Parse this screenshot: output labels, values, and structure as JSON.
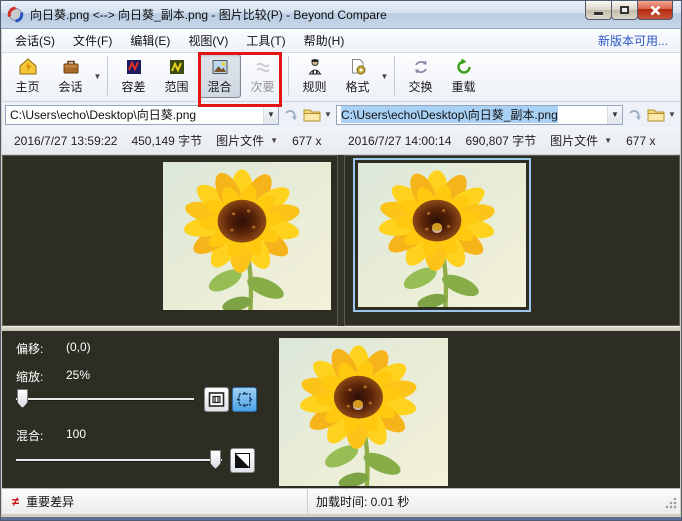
{
  "window": {
    "title": "向日葵.png <--> 向日葵_副本.png - 图片比较(P) - Beyond Compare",
    "update_link": "新版本可用..."
  },
  "menu": {
    "items": [
      {
        "label": "会话(S)"
      },
      {
        "label": "文件(F)"
      },
      {
        "label": "编辑(E)"
      },
      {
        "label": "视图(V)"
      },
      {
        "label": "工具(T)"
      },
      {
        "label": "帮助(H)"
      }
    ]
  },
  "toolbar": {
    "buttons": [
      {
        "label": "主页"
      },
      {
        "label": "会话"
      },
      {
        "label": "容差"
      },
      {
        "label": "范围"
      },
      {
        "label": "混合"
      },
      {
        "label": "次要"
      },
      {
        "label": "规则"
      },
      {
        "label": "格式"
      },
      {
        "label": "交换"
      },
      {
        "label": "重载"
      }
    ]
  },
  "paths": {
    "left_value": "C:\\Users\\echo\\Desktop\\向日葵.png",
    "right_value": "C:\\Users\\echo\\Desktop\\向日葵_副本.png"
  },
  "file_info": {
    "left": {
      "modified": "2016/7/27 13:59:22",
      "size": "450,149 字节",
      "type": "图片文件",
      "dimensions": "677 x"
    },
    "right": {
      "modified": "2016/7/27 14:00:14",
      "size": "690,807 字节",
      "type": "图片文件",
      "dimensions": "677 x"
    }
  },
  "controls": {
    "offset_label": "偏移:",
    "offset_value": "(0,0)",
    "zoom_label": "缩放:",
    "zoom_value": "25%",
    "blend_label": "混合:",
    "blend_value": "100"
  },
  "status_bar": {
    "diff_symbol": "≠",
    "diff_label": "重要差异",
    "load_time": "加载时间: 0.01 秒"
  },
  "colors": {
    "annotation_red": "#e31515",
    "selection_blue": "#a9d0f5",
    "panel_dark": "#2e2d24"
  }
}
